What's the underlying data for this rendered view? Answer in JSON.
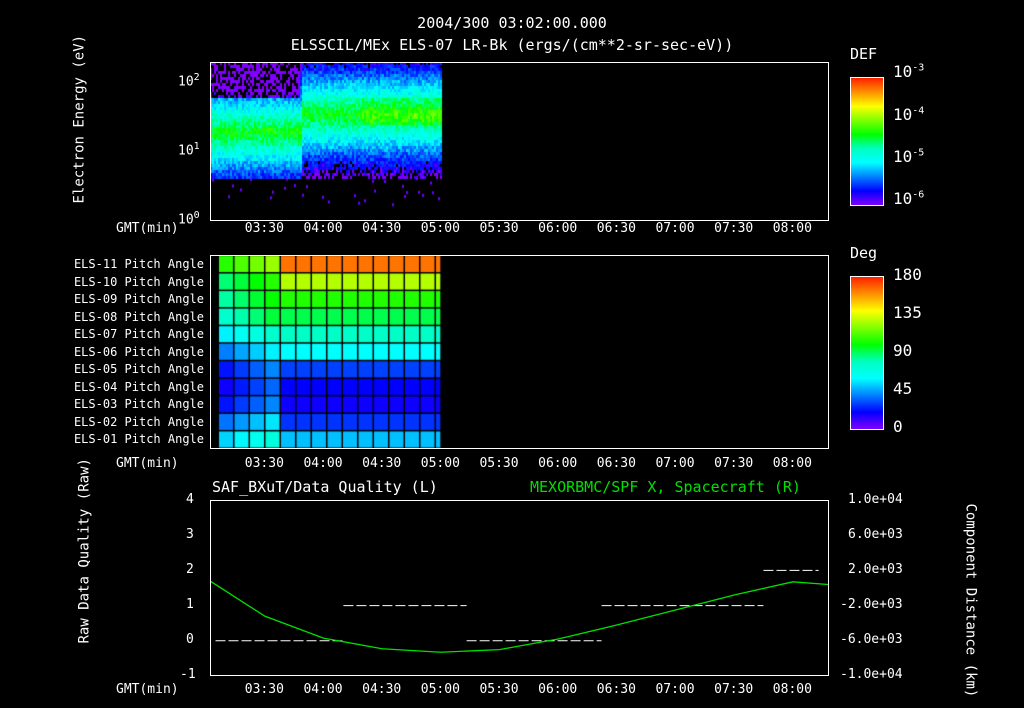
{
  "header": {
    "time": "2004/300 03:02:00.000",
    "instrument": "ELSSCIL/MEx ELS-07 LR-Bk  (ergs/(cm**2-sr-sec-eV))"
  },
  "time_axis": {
    "label": "GMT(min)",
    "ticks": [
      "03:30",
      "04:00",
      "04:30",
      "05:00",
      "05:30",
      "06:00",
      "06:30",
      "07:00",
      "07:30",
      "08:00"
    ],
    "tick_hours": [
      3.5,
      4,
      4.5,
      5,
      5.5,
      6,
      6.5,
      7,
      7.5,
      8
    ],
    "range_hours": [
      3.033,
      8.3
    ]
  },
  "chart_data": [
    {
      "type": "heatmap",
      "title": "ELSSCIL/MEx ELS-07 LR-Bk",
      "ylabel": "Electron Energy (eV)",
      "yscale": "log",
      "ylim": [
        1,
        150
      ],
      "yticks": [
        "10",
        "10",
        "10"
      ],
      "ytick_exp": [
        "0",
        "1",
        "2"
      ],
      "data_end_hour": 5.0,
      "data_energy_range": [
        4,
        150
      ],
      "colorbar": {
        "label": "DEF",
        "base": [
          "10",
          "10",
          "10",
          "10"
        ],
        "exp": [
          "-3",
          "-4",
          "-5",
          "-6"
        ],
        "range": [
          1e-06,
          0.001
        ]
      }
    },
    {
      "type": "heatmap",
      "ylabel": "Pitch Angle",
      "rows": [
        "ELS-11 Pitch Angle",
        "ELS-10 Pitch Angle",
        "ELS-09 Pitch Angle",
        "ELS-08 Pitch Angle",
        "ELS-07 Pitch Angle",
        "ELS-06 Pitch Angle",
        "ELS-05 Pitch Angle",
        "ELS-04 Pitch Angle",
        "ELS-03 Pitch Angle",
        "ELS-02 Pitch Angle",
        "ELS-01 Pitch Angle"
      ],
      "values_late_deg": [
        165,
        128,
        105,
        92,
        78,
        60,
        30,
        20,
        18,
        28,
        50
      ],
      "values_early_deg": [
        118,
        100,
        95,
        88,
        70,
        52,
        35,
        30,
        35,
        50,
        65
      ],
      "data_end_hour": 5.0,
      "colorbar": {
        "label": "Deg",
        "ticks": [
          "180",
          "135",
          "90",
          "45",
          "0"
        ],
        "range": [
          0,
          180
        ]
      }
    },
    {
      "type": "line",
      "left_title": "SAF_BXuT/Data Quality (L)",
      "right_title": "MEXORBMC/SPF X, Spacecraft (R)",
      "ylabel_left": "Raw Data Quality (Raw)",
      "ylabel_right": "Component Distance (km)",
      "ylim_left": [
        -1,
        4
      ],
      "yticks_left": [
        "4",
        "3",
        "2",
        "1",
        "0",
        "-1"
      ],
      "ylim_right": [
        -10000,
        10000
      ],
      "yticks_right": [
        "1.0e+04",
        "6.0e+03",
        "2.0e+03",
        "-2.0e+03",
        "-6.0e+03",
        "-1.0e+04"
      ],
      "quality_segments": [
        {
          "start": 3.08,
          "end": 4.17,
          "value": 0
        },
        {
          "start": 4.17,
          "end": 5.22,
          "value": 1
        },
        {
          "start": 5.22,
          "end": 6.37,
          "value": 0
        },
        {
          "start": 6.37,
          "end": 7.75,
          "value": 1
        },
        {
          "start": 7.75,
          "end": 8.22,
          "value": 2
        }
      ],
      "spacecraft_x_km": {
        "x": [
          3.033,
          3.5,
          4.0,
          4.5,
          5.0,
          5.5,
          6.0,
          6.5,
          7.0,
          7.5,
          8.0,
          8.3
        ],
        "y": [
          800,
          -3200,
          -5700,
          -6900,
          -7300,
          -7000,
          -5800,
          -4200,
          -2500,
          -800,
          700,
          400
        ]
      },
      "colors": {
        "line": "#00e000",
        "quality": "#ffffff"
      }
    }
  ]
}
